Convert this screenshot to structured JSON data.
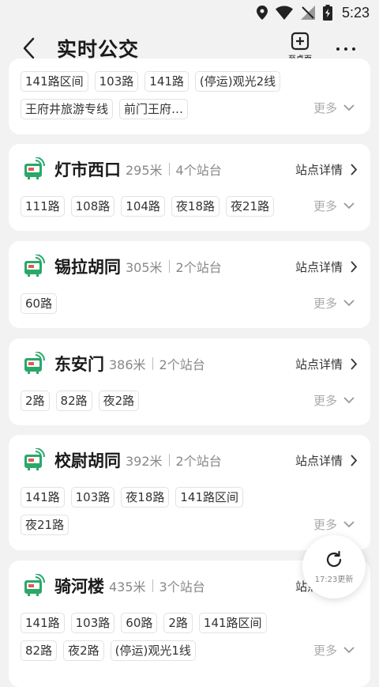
{
  "status_bar": {
    "time": "5:23"
  },
  "header": {
    "title": "实时公交",
    "desk_label": "至桌面"
  },
  "cards": [
    {
      "routes_row1": [
        "141路区间",
        "103路",
        "141路",
        "(停运)观光2线"
      ],
      "routes_row2": [
        "王府井旅游专线",
        "前门王府…"
      ],
      "more": "更多"
    },
    {
      "name": "灯市西口",
      "distance": "295米",
      "stops": "4个站台",
      "detail": "站点详情",
      "routes_row1": [
        "111路",
        "108路",
        "104路",
        "夜18路",
        "夜21路"
      ],
      "more": "更多"
    },
    {
      "name": "锡拉胡同",
      "distance": "305米",
      "stops": "2个站台",
      "detail": "站点详情",
      "routes_row1": [
        "60路"
      ],
      "more": "更多"
    },
    {
      "name": "东安门",
      "distance": "386米",
      "stops": "2个站台",
      "detail": "站点详情",
      "routes_row1": [
        "2路",
        "82路",
        "夜2路"
      ],
      "more": "更多"
    },
    {
      "name": "校尉胡同",
      "distance": "392米",
      "stops": "2个站台",
      "detail": "站点详情",
      "routes_row1": [
        "141路",
        "103路",
        "夜18路",
        "141路区间"
      ],
      "routes_row2": [
        "夜21路"
      ],
      "more": "更多"
    },
    {
      "name": "骑河楼",
      "distance": "435米",
      "stops": "3个站台",
      "detail": "站点详情",
      "routes_row1": [
        "141路",
        "103路",
        "60路",
        "2路",
        "141路区间"
      ],
      "routes_row2": [
        "82路",
        "夜2路",
        "(停运)观光1线"
      ],
      "more": "更多"
    }
  ],
  "refresh": {
    "label": "17:23更新"
  },
  "colors": {
    "accent_green": "#2aa86a",
    "bus_red": "#e05a4f"
  }
}
